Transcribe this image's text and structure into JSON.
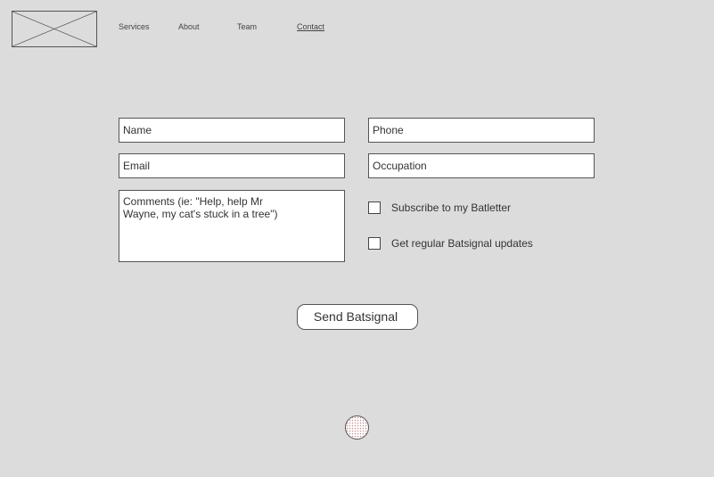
{
  "logo": {
    "icon": "image-placeholder-icon"
  },
  "nav": {
    "services": "Services",
    "about": "About",
    "team": "Team",
    "contact": "Contact"
  },
  "form": {
    "name_placeholder": "Name",
    "phone_placeholder": "Phone",
    "email_placeholder": "Email",
    "occupation_placeholder": "Occupation",
    "comments_placeholder": "Comments (ie: \"Help, help Mr\nWayne, my cat's stuck in a tree\")",
    "subscribe_label": "Subscribe to my Batletter",
    "updates_label": "Get regular Batsignal updates",
    "subscribe_checked": false,
    "updates_checked": false,
    "submit_label": "Send Batsignal"
  },
  "colors": {
    "background": "#dcdcdc",
    "field": "#ffffff",
    "border": "#555555",
    "dot_pattern": "#c98f8f"
  }
}
